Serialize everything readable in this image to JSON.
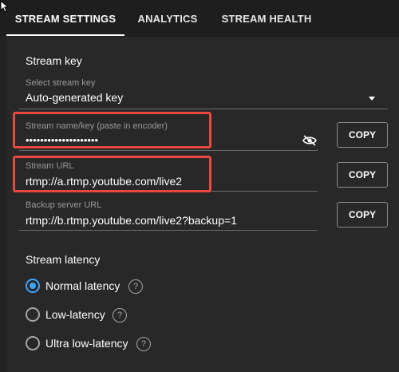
{
  "tabs": [
    {
      "label": "STREAM SETTINGS",
      "active": true
    },
    {
      "label": "ANALYTICS",
      "active": false
    },
    {
      "label": "STREAM HEALTH",
      "active": false
    }
  ],
  "stream_key": {
    "title": "Stream key",
    "select_label": "Select stream key",
    "select_value": "Auto-generated key",
    "name_label": "Stream name/key (paste in encoder)",
    "name_value": "••••••••••••••••••••",
    "url_label": "Stream URL",
    "url_value": "rtmp://a.rtmp.youtube.com/live2",
    "backup_label": "Backup server URL",
    "backup_value": "rtmp://b.rtmp.youtube.com/live2?backup=1",
    "copy_label": "COPY"
  },
  "latency": {
    "title": "Stream latency",
    "options": [
      {
        "label": "Normal latency",
        "selected": true
      },
      {
        "label": "Low-latency",
        "selected": false
      },
      {
        "label": "Ultra low-latency",
        "selected": false
      }
    ],
    "help_glyph": "?"
  },
  "colors": {
    "accent": "#3ea6ff",
    "highlight": "#e8483d",
    "background": "#282828"
  }
}
